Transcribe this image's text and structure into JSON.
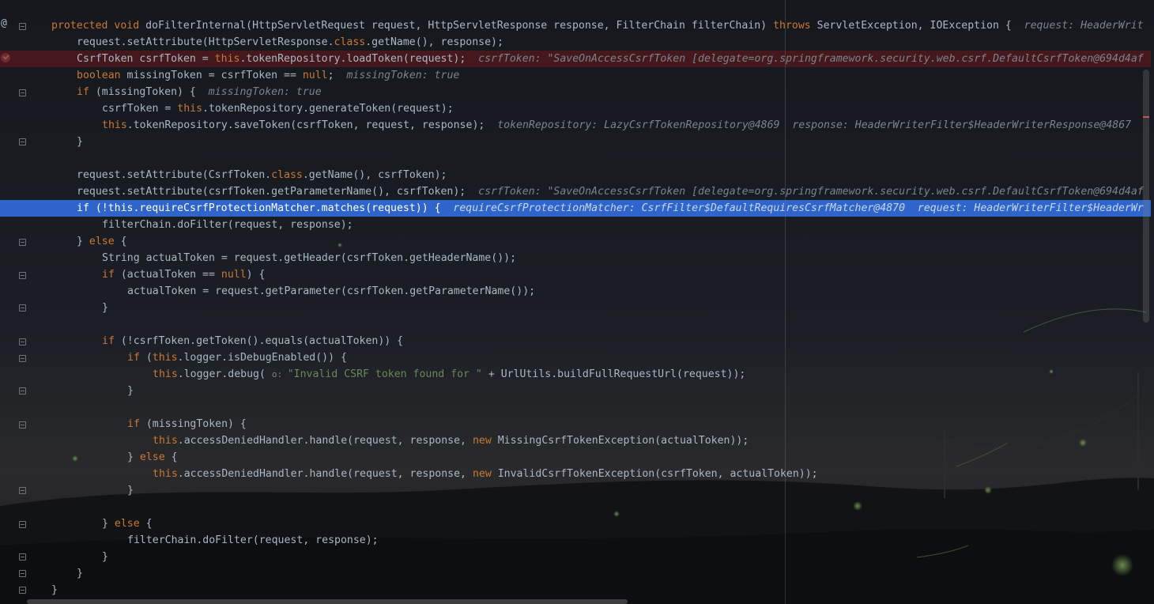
{
  "editor": {
    "colors": {
      "keyword": "#cc7832",
      "identifier": "#a9b7c6",
      "string": "#6a8759",
      "inline_value": "#7b838d",
      "execution_line": "#2f65ca",
      "breakpoint_line": "#56181c"
    },
    "gutter_icons": [
      "at-sign-icon",
      "breakpoint-icon",
      "execution-point-icon",
      "fold-icon"
    ],
    "lines": [
      {
        "indent": 0,
        "tokens": [
          {
            "t": "protected void ",
            "c": "kw"
          },
          {
            "t": "doFilterInternal(HttpServletRequest request, HttpServletResponse response, FilterChain filterChain) ",
            "c": "t"
          },
          {
            "t": "throws ",
            "c": "kw"
          },
          {
            "t": "ServletException, IOException {  ",
            "c": "t"
          },
          {
            "t": "request: HeaderWrit",
            "c": "hint"
          }
        ]
      },
      {
        "indent": 1,
        "tokens": [
          {
            "t": "request.setAttribute(HttpServletResponse.",
            "c": "t"
          },
          {
            "t": "class",
            "c": "kw"
          },
          {
            "t": ".getName(), response);",
            "c": "t"
          }
        ]
      },
      {
        "indent": 1,
        "tokens": [
          {
            "t": "CsrfToken csrfToken = ",
            "c": "t"
          },
          {
            "t": "this",
            "c": "kw"
          },
          {
            "t": ".tokenRepository.loadToken(request);  ",
            "c": "t"
          },
          {
            "t": "csrfToken: \"SaveOnAccessCsrfToken [delegate=org.springframework.security.web.csrf.DefaultCsrfToken@694d4af",
            "c": "hint"
          }
        ]
      },
      {
        "indent": 1,
        "tokens": [
          {
            "t": "boolean ",
            "c": "kw"
          },
          {
            "t": "missingToken = csrfToken == ",
            "c": "t"
          },
          {
            "t": "null",
            "c": "kw"
          },
          {
            "t": ";  ",
            "c": "t"
          },
          {
            "t": "missingToken: true",
            "c": "hint"
          }
        ]
      },
      {
        "indent": 1,
        "tokens": [
          {
            "t": "if ",
            "c": "kw"
          },
          {
            "t": "(missingToken) {  ",
            "c": "t"
          },
          {
            "t": "missingToken: true",
            "c": "hint"
          }
        ]
      },
      {
        "indent": 2,
        "tokens": [
          {
            "t": "csrfToken = ",
            "c": "t"
          },
          {
            "t": "this",
            "c": "kw"
          },
          {
            "t": ".tokenRepository.generateToken(request);",
            "c": "t"
          }
        ]
      },
      {
        "indent": 2,
        "tokens": [
          {
            "t": "this",
            "c": "kw"
          },
          {
            "t": ".tokenRepository.saveToken(csrfToken, request, response);  ",
            "c": "t"
          },
          {
            "t": "tokenRepository: LazyCsrfTokenRepository@4869  response: HeaderWriterFilter$HeaderWriterResponse@4867",
            "c": "hint"
          }
        ]
      },
      {
        "indent": 1,
        "tokens": [
          {
            "t": "}",
            "c": "t"
          }
        ]
      },
      {
        "indent": 0,
        "tokens": []
      },
      {
        "indent": 1,
        "tokens": [
          {
            "t": "request.setAttribute(CsrfToken.",
            "c": "t"
          },
          {
            "t": "class",
            "c": "kw"
          },
          {
            "t": ".getName(), csrfToken);",
            "c": "t"
          }
        ]
      },
      {
        "indent": 1,
        "tokens": [
          {
            "t": "request.setAttribute(csrfToken.getParameterName(), csrfToken);  ",
            "c": "t"
          },
          {
            "t": "csrfToken: \"SaveOnAccessCsrfToken [delegate=org.springframework.security.web.csrf.DefaultCsrfToken@694d4af",
            "c": "hint"
          }
        ]
      },
      {
        "indent": 1,
        "tokens": [
          {
            "t": "if ",
            "c": "kw"
          },
          {
            "t": "(!",
            "c": "t"
          },
          {
            "t": "this",
            "c": "kw"
          },
          {
            "t": ".requireCsrfProtectionMatcher.matches(request)) {  ",
            "c": "t"
          },
          {
            "t": "requireCsrfProtectionMatcher: CsrfFilter$DefaultRequiresCsrfMatcher@4870  request: HeaderWriterFilter$HeaderWr",
            "c": "hint"
          }
        ]
      },
      {
        "indent": 2,
        "tokens": [
          {
            "t": "filterChain.doFilter(request, response);",
            "c": "t"
          }
        ]
      },
      {
        "indent": 1,
        "tokens": [
          {
            "t": "} ",
            "c": "t"
          },
          {
            "t": "else ",
            "c": "kw"
          },
          {
            "t": "{",
            "c": "t"
          }
        ]
      },
      {
        "indent": 2,
        "tokens": [
          {
            "t": "String actualToken = request.getHeader(csrfToken.getHeaderName());",
            "c": "t"
          }
        ]
      },
      {
        "indent": 2,
        "tokens": [
          {
            "t": "if ",
            "c": "kw"
          },
          {
            "t": "(actualToken == ",
            "c": "t"
          },
          {
            "t": "null",
            "c": "kw"
          },
          {
            "t": ") {",
            "c": "t"
          }
        ]
      },
      {
        "indent": 3,
        "tokens": [
          {
            "t": "actualToken = request.getParameter(csrfToken.getParameterName());",
            "c": "t"
          }
        ]
      },
      {
        "indent": 2,
        "tokens": [
          {
            "t": "}",
            "c": "t"
          }
        ]
      },
      {
        "indent": 0,
        "tokens": []
      },
      {
        "indent": 2,
        "tokens": [
          {
            "t": "if ",
            "c": "kw"
          },
          {
            "t": "(!csrfToken.getToken().equals(actualToken)) {",
            "c": "t"
          }
        ]
      },
      {
        "indent": 3,
        "tokens": [
          {
            "t": "if ",
            "c": "kw"
          },
          {
            "t": "(",
            "c": "t"
          },
          {
            "t": "this",
            "c": "kw"
          },
          {
            "t": ".logger.isDebugEnabled()) {",
            "c": "t"
          }
        ]
      },
      {
        "indent": 4,
        "tokens": [
          {
            "t": "this",
            "c": "kw"
          },
          {
            "t": ".logger.debug( ",
            "c": "t"
          },
          {
            "t": "o: ",
            "c": "phint"
          },
          {
            "t": "\"Invalid CSRF token found for \" ",
            "c": "str"
          },
          {
            "t": "+ UrlUtils.buildFullRequestUrl(request));",
            "c": "t"
          }
        ]
      },
      {
        "indent": 3,
        "tokens": [
          {
            "t": "}",
            "c": "t"
          }
        ]
      },
      {
        "indent": 0,
        "tokens": []
      },
      {
        "indent": 3,
        "tokens": [
          {
            "t": "if ",
            "c": "kw"
          },
          {
            "t": "(missingToken) {",
            "c": "t"
          }
        ]
      },
      {
        "indent": 4,
        "tokens": [
          {
            "t": "this",
            "c": "kw"
          },
          {
            "t": ".accessDeniedHandler.handle(request, response, ",
            "c": "t"
          },
          {
            "t": "new ",
            "c": "kw"
          },
          {
            "t": "MissingCsrfTokenException(actualToken));",
            "c": "t"
          }
        ]
      },
      {
        "indent": 3,
        "tokens": [
          {
            "t": "} ",
            "c": "t"
          },
          {
            "t": "else ",
            "c": "kw"
          },
          {
            "t": "{",
            "c": "t"
          }
        ]
      },
      {
        "indent": 4,
        "tokens": [
          {
            "t": "this",
            "c": "kw"
          },
          {
            "t": ".accessDeniedHandler.handle(request, response, ",
            "c": "t"
          },
          {
            "t": "new ",
            "c": "kw"
          },
          {
            "t": "InvalidCsrfTokenException(csrfToken, actualToken));",
            "c": "t"
          }
        ]
      },
      {
        "indent": 3,
        "tokens": [
          {
            "t": "}",
            "c": "t"
          }
        ]
      },
      {
        "indent": 0,
        "tokens": []
      },
      {
        "indent": 2,
        "tokens": [
          {
            "t": "} ",
            "c": "t"
          },
          {
            "t": "else ",
            "c": "kw"
          },
          {
            "t": "{",
            "c": "t"
          }
        ]
      },
      {
        "indent": 3,
        "tokens": [
          {
            "t": "filterChain.doFilter(request, response);",
            "c": "t"
          }
        ]
      },
      {
        "indent": 2,
        "tokens": [
          {
            "t": "}",
            "c": "t"
          }
        ]
      },
      {
        "indent": 1,
        "tokens": [
          {
            "t": "}",
            "c": "t"
          }
        ]
      },
      {
        "indent": 0,
        "tokens": [
          {
            "t": "}",
            "c": "t"
          }
        ]
      }
    ]
  }
}
